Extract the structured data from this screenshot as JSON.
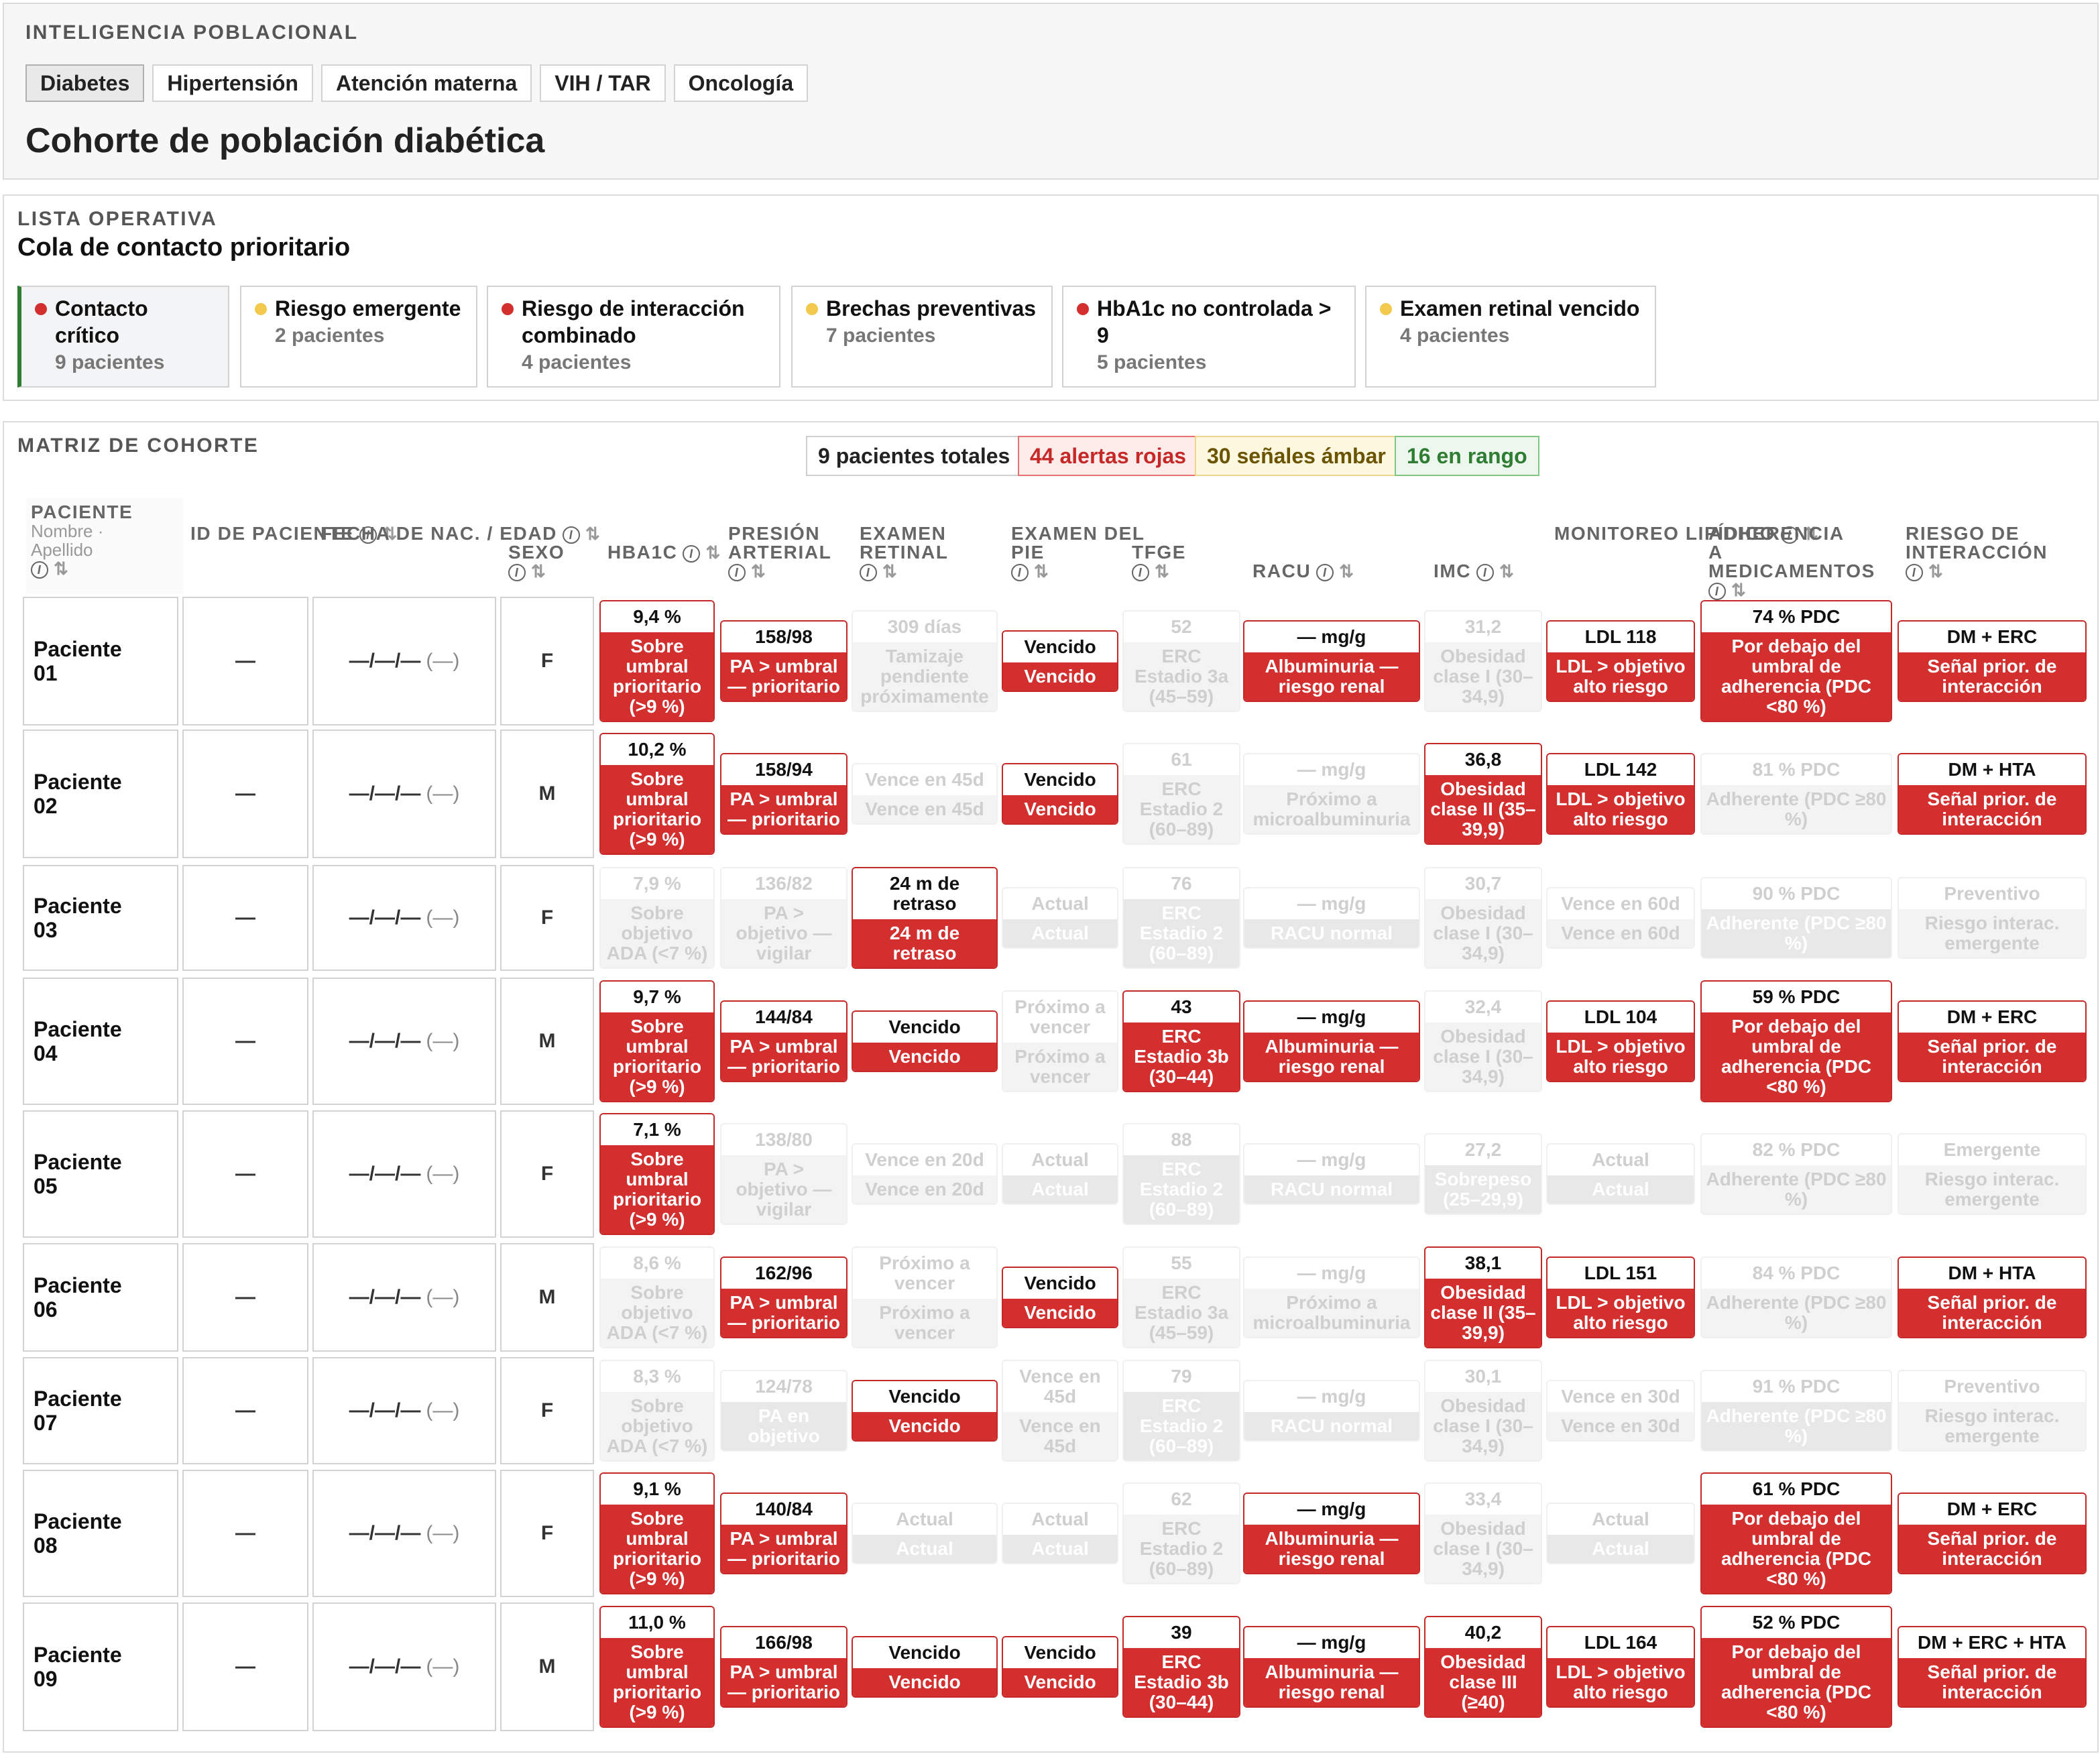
{
  "header": {
    "kicker": "INTELIGENCIA POBLACIONAL",
    "tabs": [
      "Diabetes",
      "Hipertensión",
      "Atención materna",
      "VIH / TAR",
      "Oncología"
    ],
    "active_tab": "Diabetes",
    "title": "Cohorte de población diabética"
  },
  "worklist": {
    "kicker": "LISTA OPERATIVA",
    "title": "Cola de contacto prioritario",
    "queues": [
      {
        "label": "Contacto crítico",
        "count": "9 pacientes",
        "severity": "red"
      },
      {
        "label": "Riesgo emergente",
        "count": "2 pacientes",
        "severity": "amber"
      },
      {
        "label": "Riesgo de interacción combinado",
        "count": "4 pacientes",
        "severity": "red"
      },
      {
        "label": "Brechas preventivas",
        "count": "7 pacientes",
        "severity": "amber"
      },
      {
        "label": "HbA1c no controlada > 9",
        "count": "5 pacientes",
        "severity": "red"
      },
      {
        "label": "Examen retinal vencido",
        "count": "4 pacientes",
        "severity": "amber"
      }
    ]
  },
  "matrix": {
    "kicker": "MATRIZ DE COHORTE",
    "summary": {
      "total": "9 pacientes totales",
      "red": "44 alertas rojas",
      "amber": "30 señales ámbar",
      "green": "16 en rango"
    },
    "columns": {
      "patient": "PACIENTE",
      "patient_sub": "Nombre · Apellido",
      "id": "ID DE PACIENTE",
      "dob": "FECHA DE NAC. / EDAD",
      "sex": "SEXO",
      "hba1c": "HBA1C",
      "bp": "PRESIÓN ARTERIAL",
      "retinal": "EXAMEN RETINAL",
      "foot": "EXAMEN DEL PIE",
      "egfr": "TFGE",
      "uacr": "RACU",
      "bmi": "IMC",
      "lipid": "MONITOREO LIPÍDICO",
      "adherence": "ADHERENCIA A MEDICAMENTOS",
      "interaction": "RIESGO DE INTERACCIÓN"
    },
    "info_glyph": "i",
    "sort_glyph": "⇅",
    "placeholder_id": "—",
    "placeholder_dob": "—/—/—",
    "placeholder_age": "(—)",
    "rows": [
      {
        "name": "Paciente 01",
        "sex": "F",
        "cells": [
          [
            "red",
            "9,4 %",
            "Sobre umbral prioritario (>9 %)"
          ],
          [
            "red",
            "158/98",
            "PA > umbral — prioritario"
          ],
          [
            "gray",
            "309 días",
            "Tamizaje pendiente próximamente"
          ],
          [
            "red",
            "Vencido",
            "Vencido"
          ],
          [
            "gray",
            "52",
            "ERC Estadio 3a (45–59)"
          ],
          [
            "red",
            "— mg/g",
            "Albuminuria — riesgo renal"
          ],
          [
            "gray",
            "31,2",
            "Obesidad clase I (30–34,9)"
          ],
          [
            "red",
            "LDL 118",
            "LDL > objetivo alto riesgo"
          ],
          [
            "red",
            "74 % PDC",
            "Por debajo del umbral de adherencia (PDC <80 %)"
          ],
          [
            "red",
            "DM + ERC",
            "Señal prior. de interacción"
          ]
        ]
      },
      {
        "name": "Paciente 02",
        "sex": "M",
        "cells": [
          [
            "red",
            "10,2 %",
            "Sobre umbral prioritario (>9 %)"
          ],
          [
            "red",
            "158/94",
            "PA > umbral — prioritario"
          ],
          [
            "gray",
            "Vence en 45d",
            "Vence en 45d"
          ],
          [
            "red",
            "Vencido",
            "Vencido"
          ],
          [
            "gray",
            "61",
            "ERC Estadio 2 (60–89)"
          ],
          [
            "gray",
            "— mg/g",
            "Próximo a microalbuminuria"
          ],
          [
            "red",
            "36,8",
            "Obesidad clase II (35–39,9)"
          ],
          [
            "red",
            "LDL 142",
            "LDL > objetivo alto riesgo"
          ],
          [
            "gray",
            "81 % PDC",
            "Adherente (PDC ≥80 %)"
          ],
          [
            "red",
            "DM + HTA",
            "Señal prior. de interacción"
          ]
        ]
      },
      {
        "name": "Paciente 03",
        "sex": "F",
        "cells": [
          [
            "gray",
            "7,9 %",
            "Sobre objetivo ADA (<7 %)"
          ],
          [
            "gray",
            "136/82",
            "PA > objetivo — vigilar"
          ],
          [
            "red",
            "24 m de retraso",
            "24 m de retraso"
          ],
          [
            "gray2",
            "Actual",
            "Actual"
          ],
          [
            "gray2",
            "76",
            "ERC Estadio 2 (60–89)"
          ],
          [
            "gray2",
            "— mg/g",
            "RACU normal"
          ],
          [
            "gray",
            "30,7",
            "Obesidad clase I (30–34,9)"
          ],
          [
            "gray",
            "Vence en 60d",
            "Vence en 60d"
          ],
          [
            "gray2",
            "90 % PDC",
            "Adherente (PDC ≥80 %)"
          ],
          [
            "gray",
            "Preventivo",
            "Riesgo interac. emergente"
          ]
        ]
      },
      {
        "name": "Paciente 04",
        "sex": "M",
        "cells": [
          [
            "red",
            "9,7 %",
            "Sobre umbral prioritario (>9 %)"
          ],
          [
            "red",
            "144/84",
            "PA > umbral — prioritario"
          ],
          [
            "red",
            "Vencido",
            "Vencido"
          ],
          [
            "gray",
            "Próximo a vencer",
            "Próximo a vencer"
          ],
          [
            "red",
            "43",
            "ERC Estadio 3b (30–44)"
          ],
          [
            "red",
            "— mg/g",
            "Albuminuria — riesgo renal"
          ],
          [
            "gray",
            "32,4",
            "Obesidad clase I (30–34,9)"
          ],
          [
            "red",
            "LDL 104",
            "LDL > objetivo alto riesgo"
          ],
          [
            "red",
            "59 % PDC",
            "Por debajo del umbral de adherencia (PDC <80 %)"
          ],
          [
            "red",
            "DM + ERC",
            "Señal prior. de interacción"
          ]
        ]
      },
      {
        "name": "Paciente 05",
        "sex": "F",
        "cells": [
          [
            "red",
            "7,1 %",
            "Sobre umbral prioritario (>9 %)"
          ],
          [
            "gray",
            "138/80",
            "PA > objetivo — vigilar"
          ],
          [
            "gray",
            "Vence en 20d",
            "Vence en 20d"
          ],
          [
            "gray2",
            "Actual",
            "Actual"
          ],
          [
            "gray2",
            "88",
            "ERC Estadio 2 (60–89)"
          ],
          [
            "gray2",
            "— mg/g",
            "RACU normal"
          ],
          [
            "gray2",
            "27,2",
            "Sobrepeso (25–29,9)"
          ],
          [
            "gray2",
            "Actual",
            "Actual"
          ],
          [
            "gray",
            "82 % PDC",
            "Adherente (PDC ≥80 %)"
          ],
          [
            "gray",
            "Emergente",
            "Riesgo interac. emergente"
          ]
        ]
      },
      {
        "name": "Paciente 06",
        "sex": "M",
        "cells": [
          [
            "gray",
            "8,6 %",
            "Sobre objetivo ADA (<7 %)"
          ],
          [
            "red",
            "162/96",
            "PA > umbral — prioritario"
          ],
          [
            "gray",
            "Próximo a vencer",
            "Próximo a vencer"
          ],
          [
            "red",
            "Vencido",
            "Vencido"
          ],
          [
            "gray",
            "55",
            "ERC Estadio 3a (45–59)"
          ],
          [
            "gray",
            "— mg/g",
            "Próximo a microalbuminuria"
          ],
          [
            "red",
            "38,1",
            "Obesidad clase II (35–39,9)"
          ],
          [
            "red",
            "LDL 151",
            "LDL > objetivo alto riesgo"
          ],
          [
            "gray",
            "84 % PDC",
            "Adherente (PDC ≥80 %)"
          ],
          [
            "red",
            "DM + HTA",
            "Señal prior. de interacción"
          ]
        ]
      },
      {
        "name": "Paciente 07",
        "sex": "F",
        "cells": [
          [
            "gray",
            "8,3 %",
            "Sobre objetivo ADA (<7 %)"
          ],
          [
            "gray2",
            "124/78",
            "PA en objetivo"
          ],
          [
            "red",
            "Vencido",
            "Vencido"
          ],
          [
            "gray",
            "Vence en 45d",
            "Vence en 45d"
          ],
          [
            "gray2",
            "79",
            "ERC Estadio 2 (60–89)"
          ],
          [
            "gray2",
            "— mg/g",
            "RACU normal"
          ],
          [
            "gray",
            "30,1",
            "Obesidad clase I (30–34,9)"
          ],
          [
            "gray",
            "Vence en 30d",
            "Vence en 30d"
          ],
          [
            "gray2",
            "91 % PDC",
            "Adherente (PDC ≥80 %)"
          ],
          [
            "gray",
            "Preventivo",
            "Riesgo interac. emergente"
          ]
        ]
      },
      {
        "name": "Paciente 08",
        "sex": "F",
        "cells": [
          [
            "red",
            "9,1 %",
            "Sobre umbral prioritario (>9 %)"
          ],
          [
            "red",
            "140/84",
            "PA > umbral — prioritario"
          ],
          [
            "gray2",
            "Actual",
            "Actual"
          ],
          [
            "gray2",
            "Actual",
            "Actual"
          ],
          [
            "gray",
            "62",
            "ERC Estadio 2 (60–89)"
          ],
          [
            "red",
            "— mg/g",
            "Albuminuria — riesgo renal"
          ],
          [
            "gray",
            "33,4",
            "Obesidad clase I (30–34,9)"
          ],
          [
            "gray2",
            "Actual",
            "Actual"
          ],
          [
            "red",
            "61 % PDC",
            "Por debajo del umbral de adherencia (PDC <80 %)"
          ],
          [
            "red",
            "DM + ERC",
            "Señal prior. de interacción"
          ]
        ]
      },
      {
        "name": "Paciente 09",
        "sex": "M",
        "cells": [
          [
            "red",
            "11,0 %",
            "Sobre umbral prioritario (>9 %)"
          ],
          [
            "red",
            "166/98",
            "PA > umbral — prioritario"
          ],
          [
            "red",
            "Vencido",
            "Vencido"
          ],
          [
            "red",
            "Vencido",
            "Vencido"
          ],
          [
            "red",
            "39",
            "ERC Estadio 3b (30–44)"
          ],
          [
            "red",
            "— mg/g",
            "Albuminuria — riesgo renal"
          ],
          [
            "red",
            "40,2",
            "Obesidad clase III (≥40)"
          ],
          [
            "red",
            "LDL 164",
            "LDL > objetivo alto riesgo"
          ],
          [
            "red",
            "52 % PDC",
            "Por debajo del umbral de adherencia (PDC <80 %)"
          ],
          [
            "red",
            "DM + ERC + HTA",
            "Señal prior. de interacción"
          ]
        ]
      }
    ]
  },
  "colors": {
    "red": "#d32f2f",
    "amber": "#f2c94c",
    "green": "#2e7d32",
    "red_chip_bg": "#fdecea",
    "amber_chip_bg": "#fff8e1",
    "green_chip_bg": "#edf7ee"
  }
}
